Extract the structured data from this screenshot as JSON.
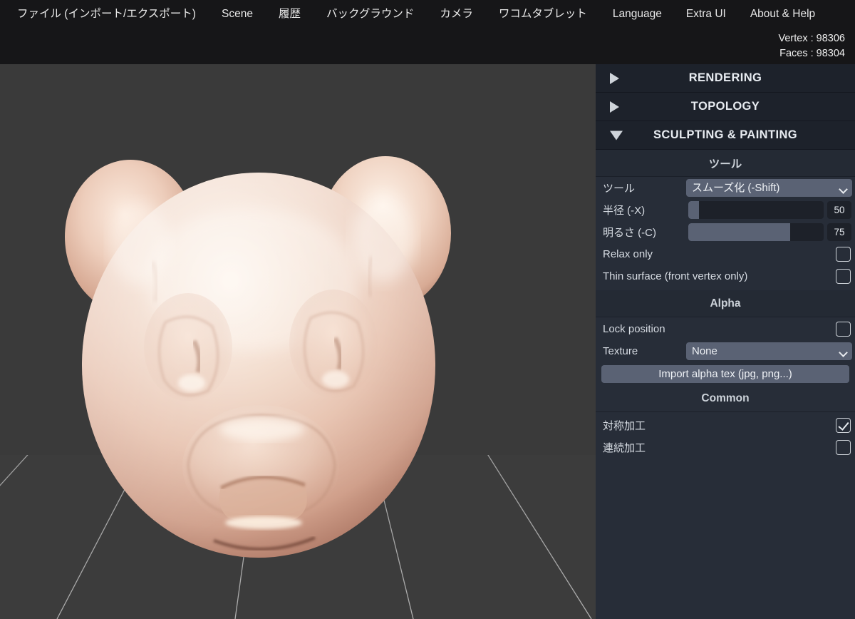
{
  "menu": {
    "items": [
      {
        "label": "ファイル (インポート/エクスポート)",
        "name": "menu-file"
      },
      {
        "label": "Scene",
        "name": "menu-scene"
      },
      {
        "label": "履歴",
        "name": "menu-history"
      },
      {
        "label": "バックグラウンド",
        "name": "menu-background"
      },
      {
        "label": "カメラ",
        "name": "menu-camera"
      },
      {
        "label": "ワコムタブレット",
        "name": "menu-wacom-tablet"
      },
      {
        "label": "Language",
        "name": "menu-language"
      },
      {
        "label": "Extra UI",
        "name": "menu-extra-ui"
      },
      {
        "label": "About & Help",
        "name": "menu-about-help"
      }
    ]
  },
  "stats": {
    "vertex": "Vertex : 98306",
    "faces": "Faces : 98304"
  },
  "panel": {
    "sections": [
      {
        "title": "RENDERING",
        "expanded": false,
        "arrow": "triangle-right-icon"
      },
      {
        "title": "TOPOLOGY",
        "expanded": false,
        "arrow": "triangle-right-icon"
      },
      {
        "title": "SCULPTING & PAINTING",
        "expanded": true,
        "arrow": "triangle-down-icon"
      }
    ],
    "tool_group": {
      "header": "ツール",
      "tool_label": "ツール",
      "tool_value": "スムーズ化 (-Shift)",
      "tool_options": [
        "スムーズ化 (-Shift)"
      ],
      "radius_label": "半径 (-X)",
      "radius_value": "50",
      "radius_percent": 8,
      "intensity_label": "明るさ (-C)",
      "intensity_value": "75",
      "intensity_percent": 75,
      "relax_only_label": "Relax only",
      "relax_only_checked": false,
      "thin_surface_label": "Thin surface (front vertex only)",
      "thin_surface_checked": false
    },
    "alpha_group": {
      "header": "Alpha",
      "lock_position_label": "Lock position",
      "lock_position_checked": false,
      "texture_label": "Texture",
      "texture_value": "None",
      "texture_options": [
        "None"
      ],
      "import_button_label": "Import alpha tex (jpg, png...)"
    },
    "common_group": {
      "header": "Common",
      "symmetry_label": "対称加工",
      "symmetry_checked": true,
      "continuous_label": "連続加工",
      "continuous_checked": false
    }
  },
  "viewport": {
    "name": "3d-viewport",
    "model_name": "bear-head-sculpt",
    "background_color": "#3a3a3a",
    "floor_color": "#3c3c3c",
    "grid_line_color": "#9a9a9a",
    "model_base_color": "#e2bda9",
    "model_shadow_color": "#9d6a57",
    "model_highlight_color": "#fbf0e6"
  }
}
